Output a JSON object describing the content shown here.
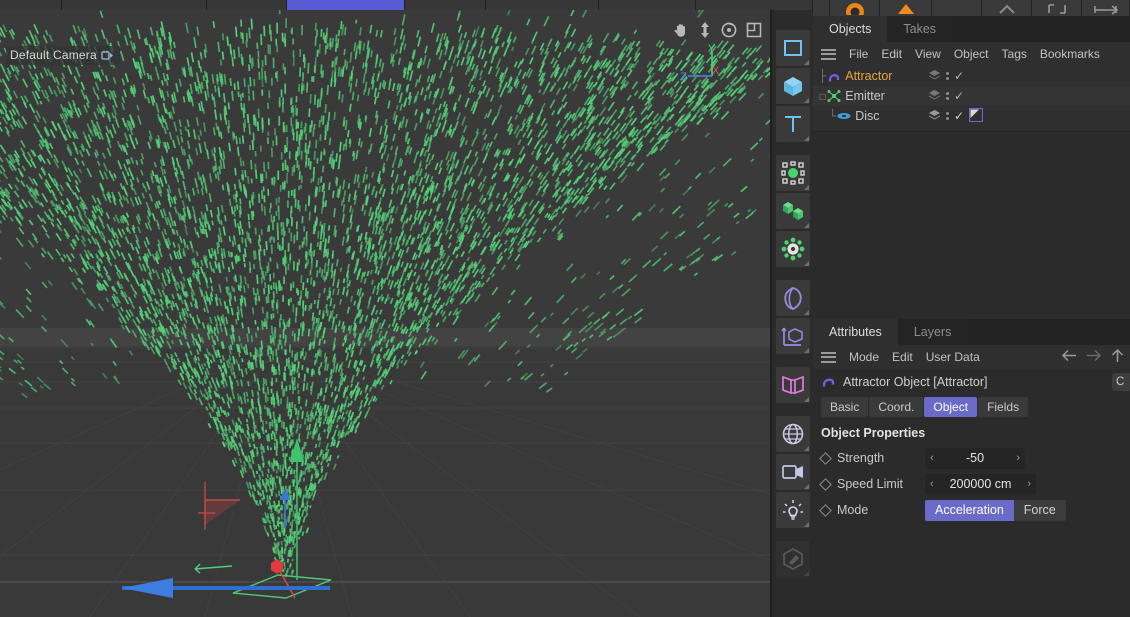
{
  "app": {
    "accent": "#6a6ac8",
    "viewport_bg": "#383838",
    "panel_bg": "#2b2b2b"
  },
  "viewport": {
    "camera_label": "Default Camera",
    "camera_lock_icon": "camera-lock-icon",
    "nav_icons": [
      "pan-hand-icon",
      "dolly-icon",
      "orbit-icon",
      "maximize-viewport-icon"
    ],
    "axis_gizmo": {
      "y": "Y",
      "x": "X",
      "z": "Z",
      "y_color": "#4fd07a",
      "x_color": "#e05a5a",
      "z_color": "#4a86e8"
    },
    "particle_color": "#55d17a",
    "emitter_disc_color": "#4fd07a",
    "attractor_line_color": "#d04a4a"
  },
  "palette": {
    "items": [
      {
        "name": "spline-pen-icon"
      },
      {
        "name": "cube-primitive-icon"
      },
      {
        "name": "text-spline-icon"
      },
      {
        "name": "deformer-icon"
      },
      {
        "name": "mograph-cloner-icon"
      },
      {
        "name": "generator-icon"
      },
      {
        "name": "field-icon"
      },
      {
        "name": "axis-object-icon"
      },
      {
        "name": "bend-deformer-icon"
      },
      {
        "name": "environment-globe-icon"
      },
      {
        "name": "camera-icon"
      },
      {
        "name": "light-icon"
      },
      {
        "name": "material-paint-icon"
      }
    ]
  },
  "objects_panel": {
    "tabs": [
      {
        "label": "Objects",
        "active": true
      },
      {
        "label": "Takes",
        "active": false
      }
    ],
    "menu": [
      "File",
      "Edit",
      "View",
      "Object",
      "Tags",
      "Bookmarks"
    ],
    "menu_icon": "hamburger-menu-icon",
    "tree": [
      {
        "label": "Attractor",
        "icon": "attractor-magnet-icon",
        "color": "orange",
        "indent": 0,
        "selected": false,
        "has_expander": false,
        "visibility_dots": true,
        "check": "✓",
        "tag": false
      },
      {
        "label": "Emitter",
        "icon": "emitter-particle-icon",
        "color": "gray",
        "indent": 0,
        "selected": true,
        "has_expander": true,
        "visibility_dots": true,
        "check": "✓",
        "tag": false
      },
      {
        "label": "Disc",
        "icon": "disc-primitive-icon",
        "color": "gray",
        "indent": 1,
        "selected": false,
        "has_expander": false,
        "visibility_dots": true,
        "check": "✓",
        "tag": true
      }
    ]
  },
  "attributes_panel": {
    "tabs": [
      {
        "label": "Attributes",
        "active": true
      },
      {
        "label": "Layers",
        "active": false
      }
    ],
    "menu": [
      "Mode",
      "Edit",
      "User Data"
    ],
    "menu_icon": "hamburger-menu-icon",
    "nav_back_icon": "arrow-left-icon",
    "nav_forward_icon": "arrow-right-icon",
    "nav_up_icon": "arrow-up-icon",
    "header": {
      "icon": "attractor-magnet-icon",
      "title": "Attractor Object [Attractor]"
    },
    "corner_button": "C",
    "subtabs": [
      {
        "label": "Basic",
        "active": false
      },
      {
        "label": "Coord.",
        "active": false
      },
      {
        "label": "Object",
        "active": true
      },
      {
        "label": "Fields",
        "active": false
      }
    ],
    "section_title": "Object Properties",
    "properties": [
      {
        "label": "Strength",
        "type": "spinner",
        "value": "-50",
        "keyframe_icon": "keyframe-diamond-icon",
        "left_arrow": "‹",
        "right_arrow": "›",
        "width": 100
      },
      {
        "label": "Speed Limit",
        "type": "spinner",
        "value": "200000 cm",
        "keyframe_icon": "keyframe-diamond-icon",
        "left_arrow": "‹",
        "right_arrow": "›",
        "width": 111
      },
      {
        "label": "Mode",
        "type": "segmented",
        "keyframe_icon": "keyframe-diamond-icon",
        "options": [
          {
            "label": "Acceleration",
            "selected": true
          },
          {
            "label": "Force",
            "selected": false
          }
        ]
      }
    ]
  }
}
